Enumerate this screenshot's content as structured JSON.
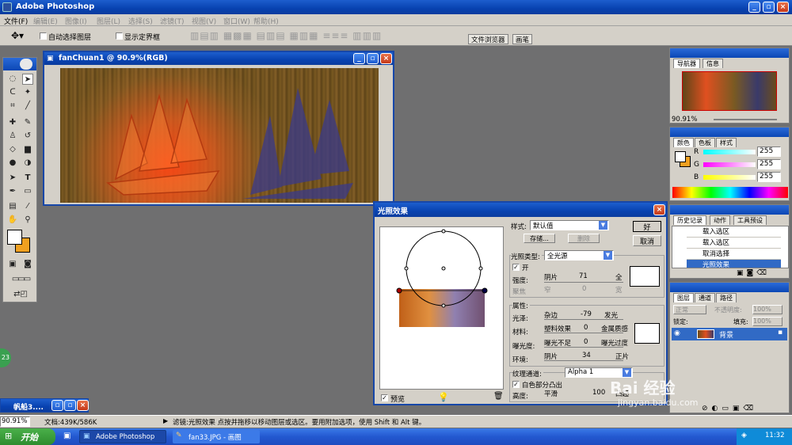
{
  "app": {
    "title": "Adobe Photoshop"
  },
  "menu": [
    "文件(F)",
    "编辑(E)",
    "图像(I)",
    "图层(L)",
    "选择(S)",
    "滤镜(T)",
    "视图(V)",
    "窗口(W)",
    "帮助(H)"
  ],
  "options": {
    "auto_select": "自动选择图层",
    "show_bounds": "显示定界框",
    "file_browser": "文件浏览器",
    "brushes": "画笔"
  },
  "doc": {
    "title": "fanChuan1 @ 90.9%(RGB)"
  },
  "navigator": {
    "tab1": "导航器",
    "tab2": "信息",
    "zoom": "90.91%"
  },
  "color_panel": {
    "tab1": "颜色",
    "tab2": "色板",
    "tab3": "样式",
    "r_label": "R",
    "g_label": "G",
    "b_label": "B",
    "r": "255",
    "g": "255",
    "b": "255"
  },
  "history": {
    "tab1": "历史记录",
    "tab2": "动作",
    "tab3": "工具预设",
    "items": [
      "载入选区",
      "载入选区",
      "取消选择",
      "光照效果"
    ]
  },
  "layers": {
    "tab1": "图层",
    "tab2": "通道",
    "tab3": "路径",
    "mode": "正常",
    "opacity_label": "不透明度:",
    "opacity": "100%",
    "lock_label": "锁定:",
    "fill_label": "填充:",
    "fill": "100%",
    "layer_name": "背景"
  },
  "dialog": {
    "title": "光照效果",
    "style_label": "样式:",
    "style_value": "默认值",
    "save": "存储...",
    "delete": "删除",
    "ok": "好",
    "cancel": "取消",
    "type_label": "光照类型:",
    "type_value": "全光源",
    "on_label": "开",
    "intensity_label": "强度:",
    "intensity_min": "阴片",
    "intensity_value": "71",
    "intensity_max": "全",
    "focus_label": "聚焦",
    "focus_min": "窄",
    "focus_value": "0",
    "focus_max": "宽",
    "props_label": "属性:",
    "gloss_label": "光泽:",
    "gloss_min": "杂边",
    "gloss_value": "-79",
    "gloss_max": "发光",
    "material_label": "材料:",
    "material_min": "塑料效果",
    "material_value": "0",
    "material_max": "金属质感",
    "exposure_label": "曝光度:",
    "exposure_min": "曝光不足",
    "exposure_value": "0",
    "exposure_max": "曝光过度",
    "ambience_label": "环境:",
    "ambience_min": "阴片",
    "ambience_value": "34",
    "ambience_max": "正片",
    "texture_label": "纹理通道:",
    "texture_value": "Alpha 1",
    "white_high": "白色部分凸出",
    "height_label": "高度:",
    "height_min": "平滑",
    "height_value": "100",
    "height_max": "凸起",
    "preview": "预览"
  },
  "minimized": {
    "title": "帆船3...."
  },
  "status": {
    "zoom": "90.91%",
    "doc_size": "文档:439K/586K",
    "hint": "滤镜:光照效果 点按并拖移以移动图层或选区。要用附加选项，使用 Shift 和 Alt 键。"
  },
  "taskbar": {
    "start": "开始",
    "task1": "Adobe Photoshop",
    "task2": "fan33.JPG - 画图",
    "clock": "11:32"
  },
  "badge": "23",
  "watermark": {
    "brand": "Bai 经验",
    "url": "jingyan.baidu.com"
  }
}
